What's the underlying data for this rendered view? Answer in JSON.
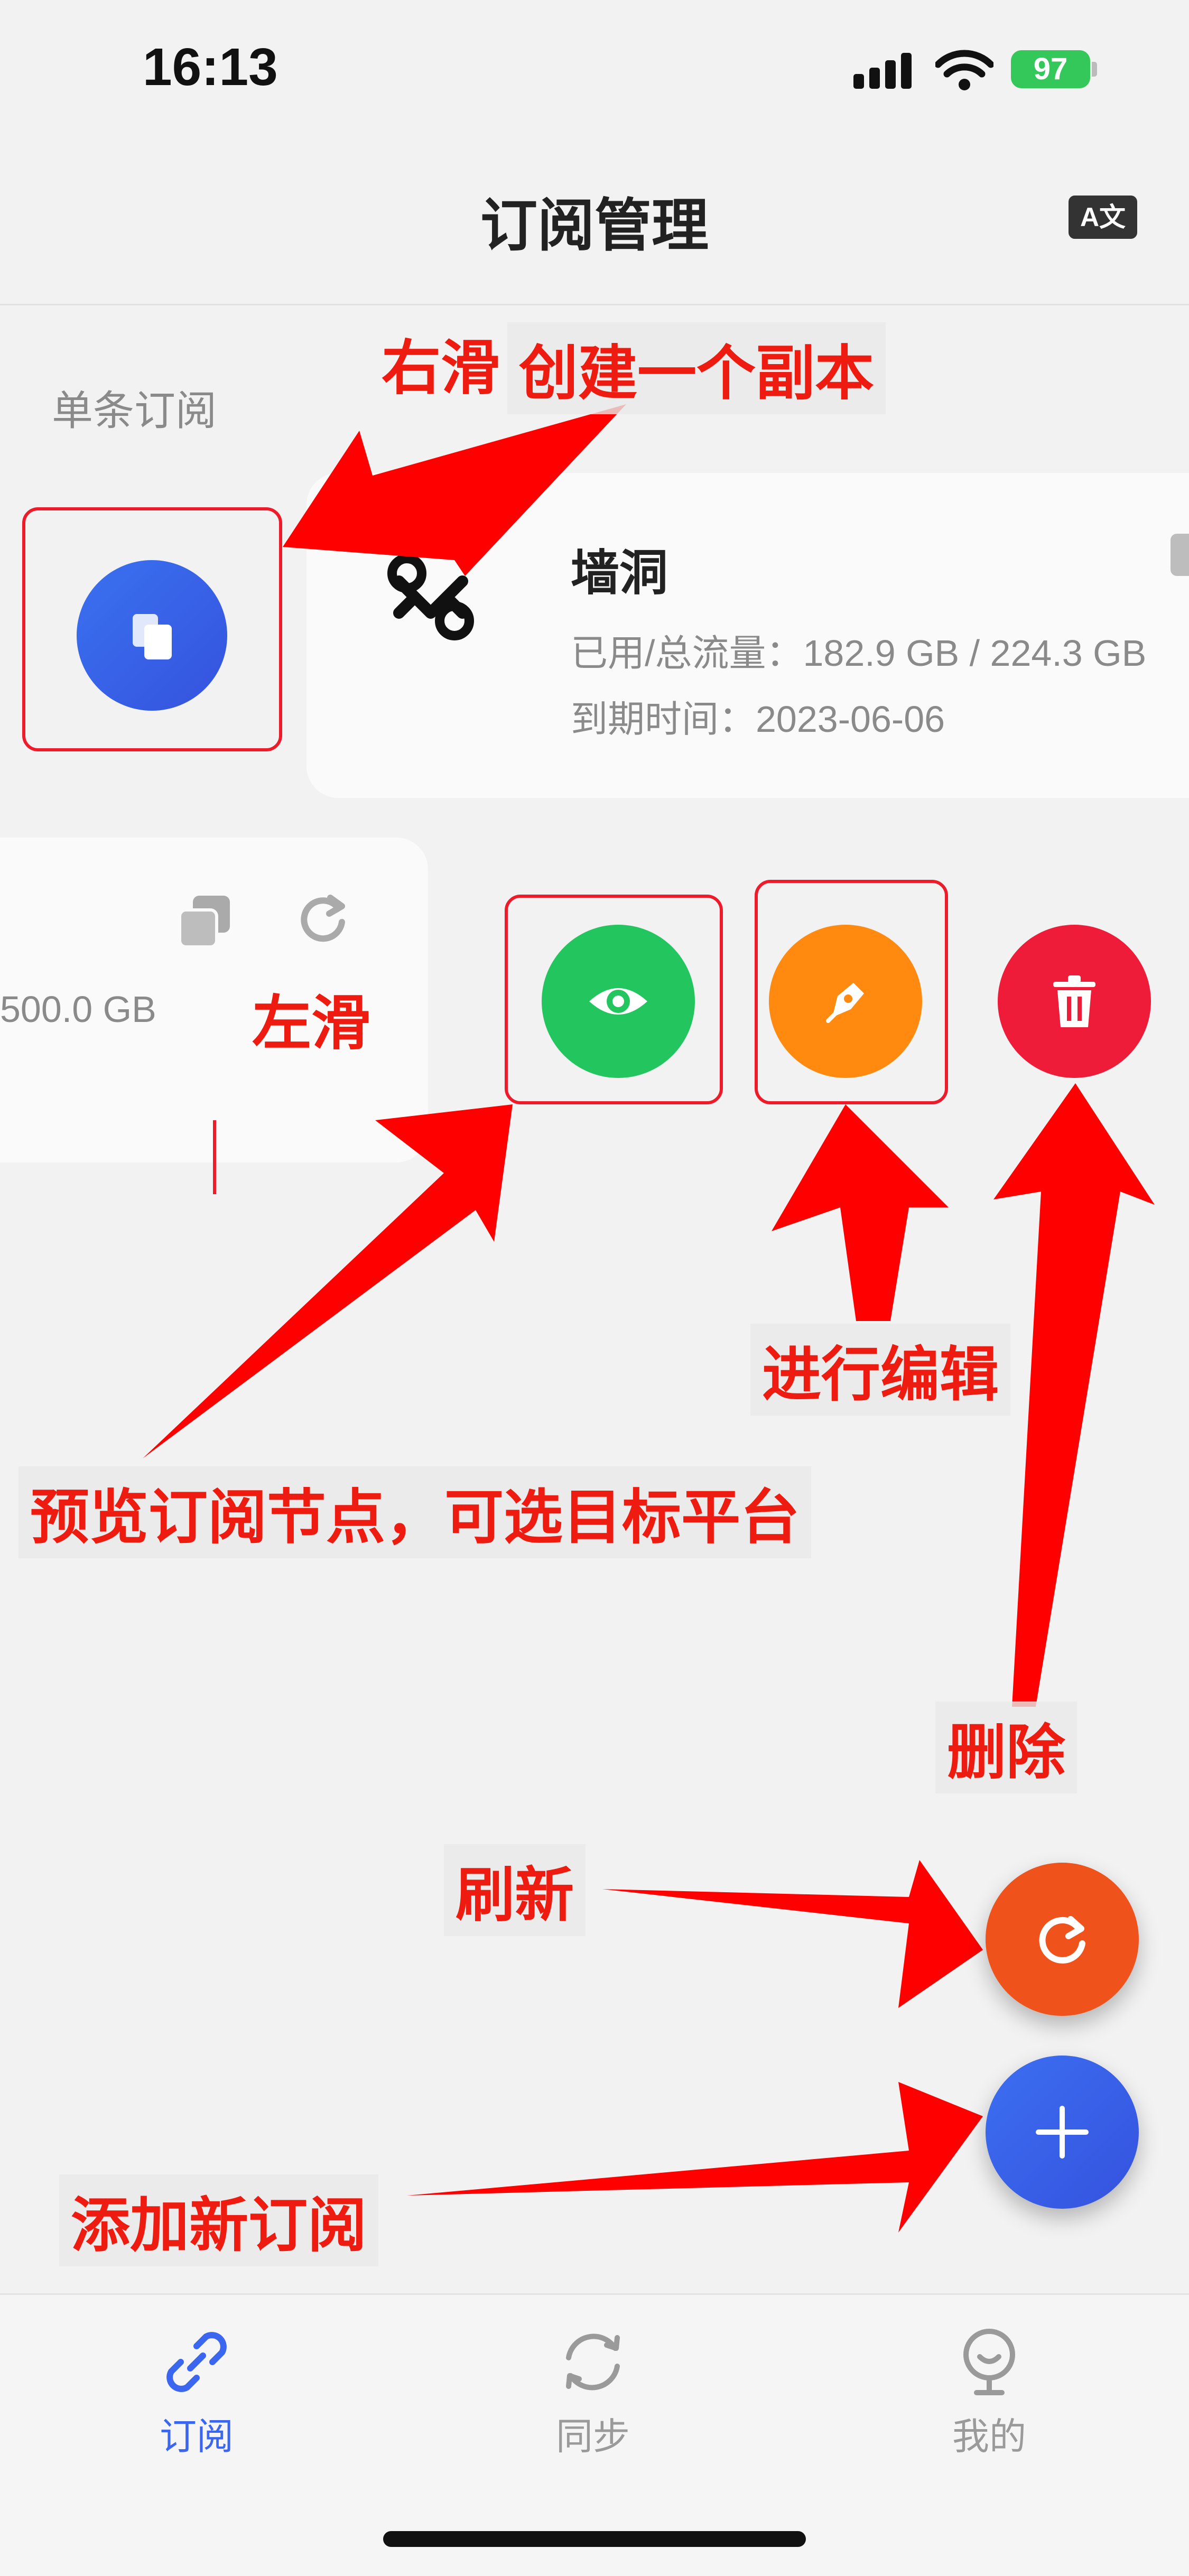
{
  "status_bar": {
    "time": "16:13",
    "battery": "97"
  },
  "header": {
    "title": "订阅管理",
    "translate_icon": "translate-icon"
  },
  "section": {
    "label": "单条订阅"
  },
  "subscriptions": [
    {
      "name": "墙洞",
      "usage_label": "已用/总流量：",
      "usage_value": "182.9 GB / 224.3 GB",
      "expiry_label": "到期时间：",
      "expiry_value": "2023-06-06"
    },
    {
      "usage_partial": "500.0 GB"
    }
  ],
  "annotations": {
    "swipe_right": "右滑",
    "create_copy": "创建一个副本",
    "swipe_left": "左滑",
    "edit": "进行编辑",
    "preview": "预览订阅节点，可选目标平台",
    "delete": "删除",
    "refresh": "刷新",
    "add_new": "添加新订阅"
  },
  "tabs": [
    {
      "label": "订阅",
      "icon": "link-icon",
      "active": true
    },
    {
      "label": "同步",
      "icon": "sync-icon",
      "active": false
    },
    {
      "label": "我的",
      "icon": "profile-icon",
      "active": false
    }
  ],
  "colors": {
    "accent_blue": "#3b66f0",
    "copy_blue": "#3a62ea",
    "preview_green": "#22c55e",
    "edit_orange": "#ff8a0f",
    "delete_red": "#ee1b39",
    "refresh_orange": "#f0521c",
    "annotation_red": "#ee1c10"
  }
}
